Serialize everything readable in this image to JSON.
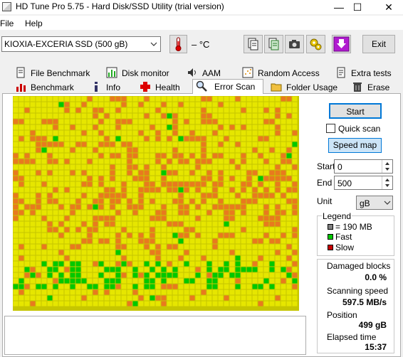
{
  "window": {
    "title": "HD Tune Pro 5.75 - Hard Disk/SSD Utility (trial version)"
  },
  "menu": {
    "file": "File",
    "help": "Help"
  },
  "toolbar": {
    "drive": "KIOXIA-EXCERIA SSD (500 gB)",
    "temperature": "– °C",
    "exit": "Exit"
  },
  "tabs_row1": [
    "File Benchmark",
    "Disk monitor",
    "AAM",
    "Random Access",
    "Extra tests"
  ],
  "tabs_row2": [
    "Benchmark",
    "Info",
    "Health",
    "Error Scan",
    "Folder Usage",
    "Erase"
  ],
  "active_tab": "Error Scan",
  "scan": {
    "start_button": "Start",
    "quick_scan_label": "Quick scan",
    "quick_scan_checked": false,
    "speed_map_button": "Speed map",
    "start_label": "Start",
    "start_value": "0",
    "end_label": "End",
    "end_value": "500",
    "unit_label": "Unit",
    "unit_value": "gB"
  },
  "legend": {
    "title": "Legend",
    "block_size": "= 190 MB",
    "fast": "Fast",
    "slow": "Slow",
    "colors": {
      "block": "#808080",
      "fast": "#00c800",
      "slow": "#c80000",
      "mid": "#e6e600",
      "orange": "#e87a1e"
    }
  },
  "stats": {
    "damaged_label": "Damaged blocks",
    "damaged_value": "0.0 %",
    "speed_label": "Scanning speed",
    "speed_value": "597.5 MB/s",
    "position_label": "Position",
    "position_value": "499 gB",
    "elapsed_label": "Elapsed time",
    "elapsed_value": "15:37"
  }
}
